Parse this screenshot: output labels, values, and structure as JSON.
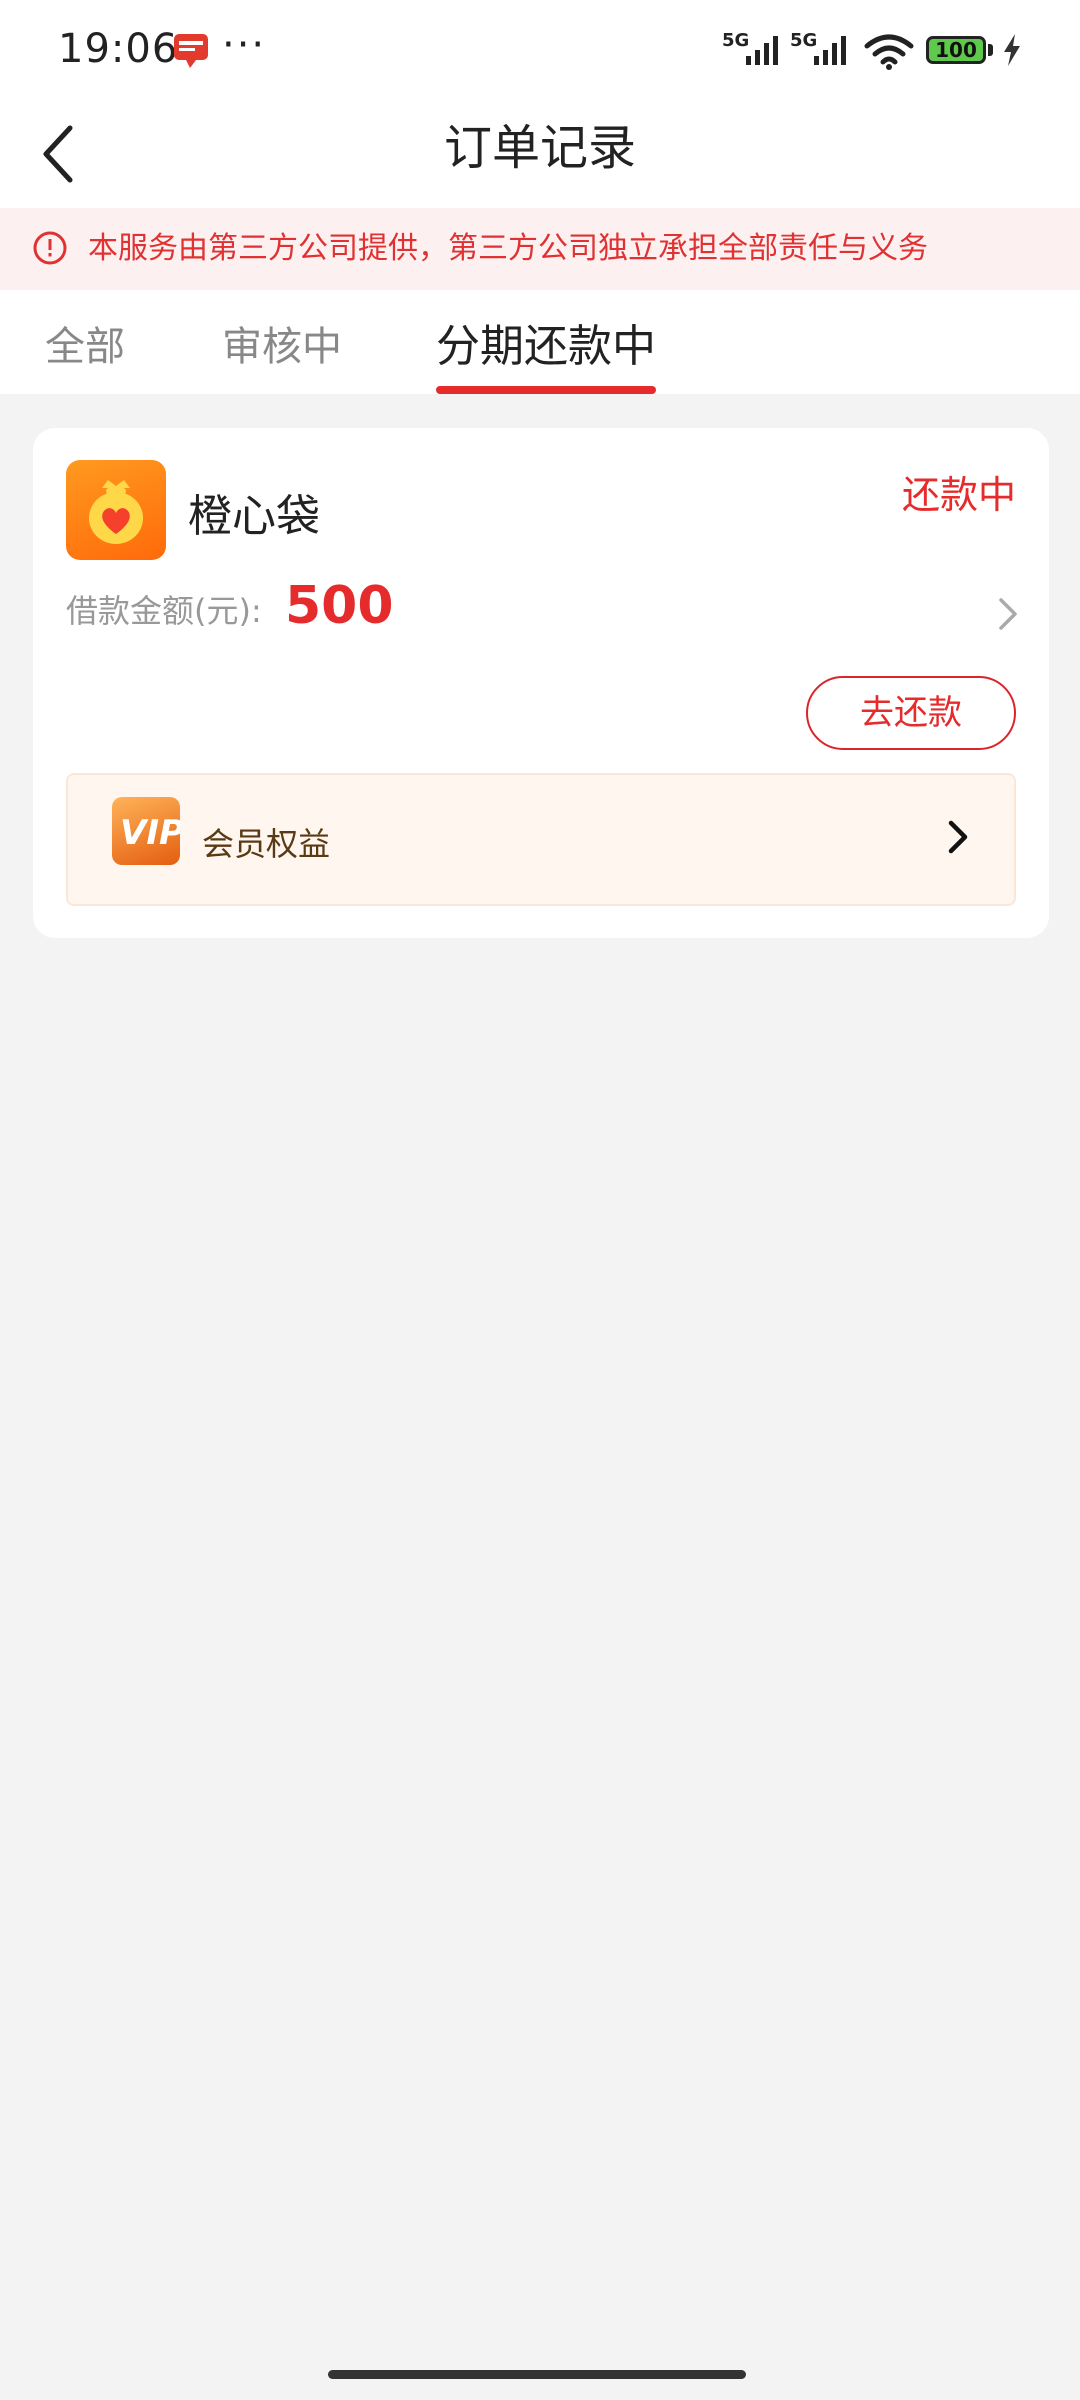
{
  "status_bar": {
    "time": "19:06",
    "more": "···",
    "sim1_label": "5G",
    "sim2_label": "5G",
    "battery_level": "100"
  },
  "header": {
    "title": "订单记录"
  },
  "notice": {
    "text": "本服务由第三方公司提供，第三方公司独立承担全部责任与义务"
  },
  "tabs": [
    {
      "label": "全部",
      "active": false
    },
    {
      "label": "审核中",
      "active": false
    },
    {
      "label": "分期还款中",
      "active": true
    }
  ],
  "order": {
    "product_name": "橙心袋",
    "status": "还款中",
    "amount_label": "借款金额(元):",
    "amount_value": "500",
    "repay_button": "去还款",
    "vip_label": "会员权益",
    "vip_badge_text": "VIP"
  },
  "colors": {
    "accent": "#e52b2b",
    "notice_bg": "#fdf0f0",
    "page_bg": "#f3f3f3",
    "vip_bg": "#fff6ef",
    "logo_orange": "#ff7a10"
  },
  "icons": {
    "back": "chevron-left-icon",
    "notice": "alert-circle-icon",
    "detail": "chevron-right-icon",
    "vip": "vip-badge-icon",
    "product": "money-bag-heart-icon"
  }
}
